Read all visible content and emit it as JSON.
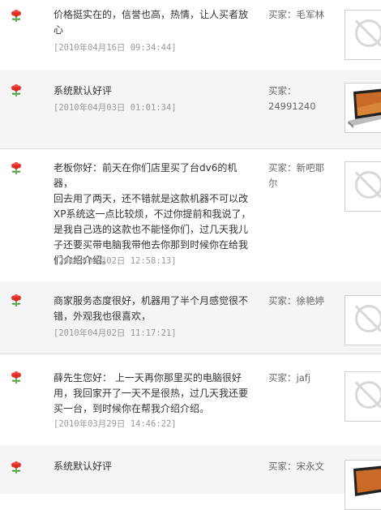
{
  "reviews": [
    {
      "comment": "价格挺实在的，信誉也高，热情，让人买者放\n心",
      "datetime": "[2010年04月16日 09:34:44]",
      "buyer": "买家：毛军林",
      "thumbnail": "placeholder-image-icon"
    },
    {
      "comment": "系统默认好评",
      "datetime": "[2010年04月03日 01:01:34]",
      "buyer": "买家：\n24991240",
      "thumbnail": "laptop-image"
    },
    {
      "comment": "老板你好：前天在你们店里买了台dv6的机器，\n回去用了两天，还不错就是这款机器不可以改\nXP系统这一点比较烦，不过你提前和我说了，\n是我自己选的这款也不能怪你们，过几天我儿\n子还要买带电脑我带他去你那到时候你在给我\n们介绍介绍。",
      "datetime": "[2010年04月02日 12:58:13]",
      "buyer": "买家：新吧耶\n尔",
      "thumbnail": "placeholder-image-icon"
    },
    {
      "comment": "商家服务态度很好，机器用了半个月感觉很不\n错，外观我也很喜欢，",
      "datetime": "[2010年04月02日 11:17:21]",
      "buyer": "买家：徐艳婷",
      "thumbnail": "placeholder-image-icon"
    },
    {
      "comment": "薛先生您好： 上一天再你那里买的电脑很好\n用，我回家开了一天不是很热，过几天我还要\n买一台，到时候你在帮我介绍介绍。",
      "datetime": "[2010年03月29日 14:46:22]",
      "buyer": "买家：jafj",
      "thumbnail": "placeholder-image-icon"
    },
    {
      "comment": "系统默认好评",
      "datetime": "",
      "buyer": "买家：宋永文",
      "thumbnail": "laptop-image"
    }
  ],
  "colors": {
    "petal": "#e8322d",
    "stem": "#3f9a2e",
    "row_shade": "#f5f5f5",
    "divider": "#dcdcdc"
  }
}
